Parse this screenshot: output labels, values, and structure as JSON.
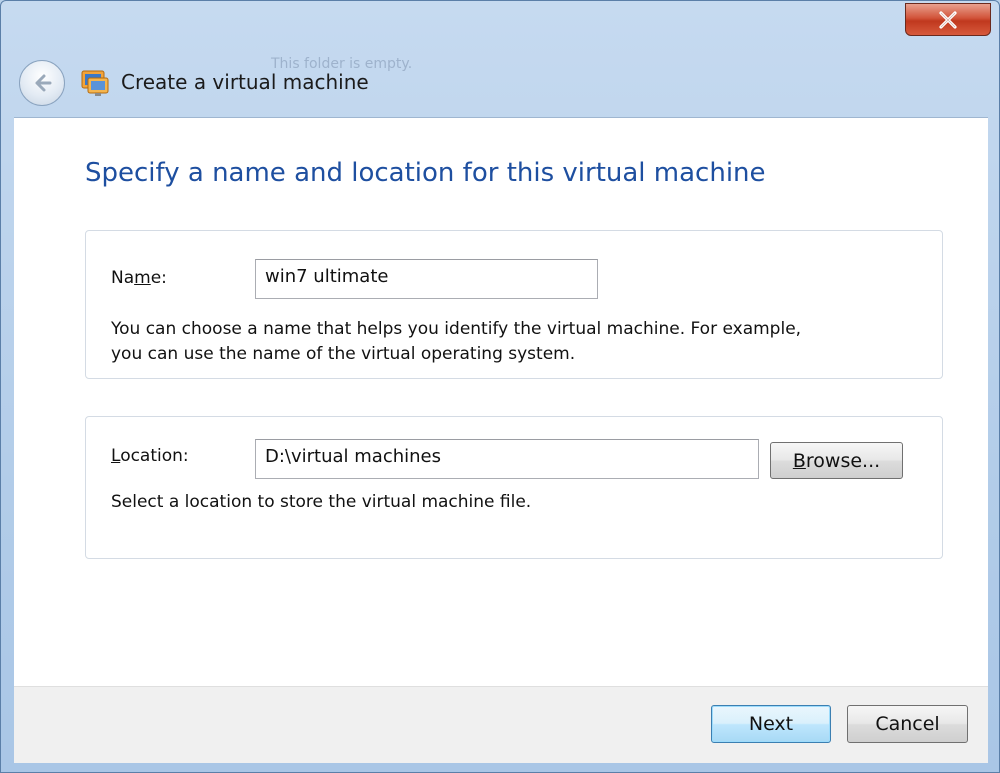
{
  "window": {
    "title": "Create a virtual machine",
    "close_label": "✕",
    "ghost_text": [
      "This folder is empty."
    ]
  },
  "page": {
    "heading": "Specify a name and location for this virtual machine"
  },
  "name_group": {
    "label_pre": "Na",
    "label_key": "m",
    "label_post": "e:",
    "value": "win7 ultimate",
    "help_line1": "You can choose a name that helps you identify the virtual machine. For example,",
    "help_line2": "you can use the name of the virtual operating system."
  },
  "location_group": {
    "label_key": "L",
    "label_post": "ocation:",
    "value": "D:\\virtual machines",
    "browse_key": "B",
    "browse_post": "rowse...",
    "help": "Select a location to store the virtual machine file."
  },
  "footer": {
    "next_label": "Next",
    "cancel_label": "Cancel"
  },
  "colors": {
    "heading": "#1e4fa0",
    "close_button": "#c9432a",
    "default_button_border": "#3c7fb1"
  },
  "icons": {
    "back": "back-arrow-icon",
    "app": "virtual-machine-icon",
    "close": "close-icon"
  }
}
